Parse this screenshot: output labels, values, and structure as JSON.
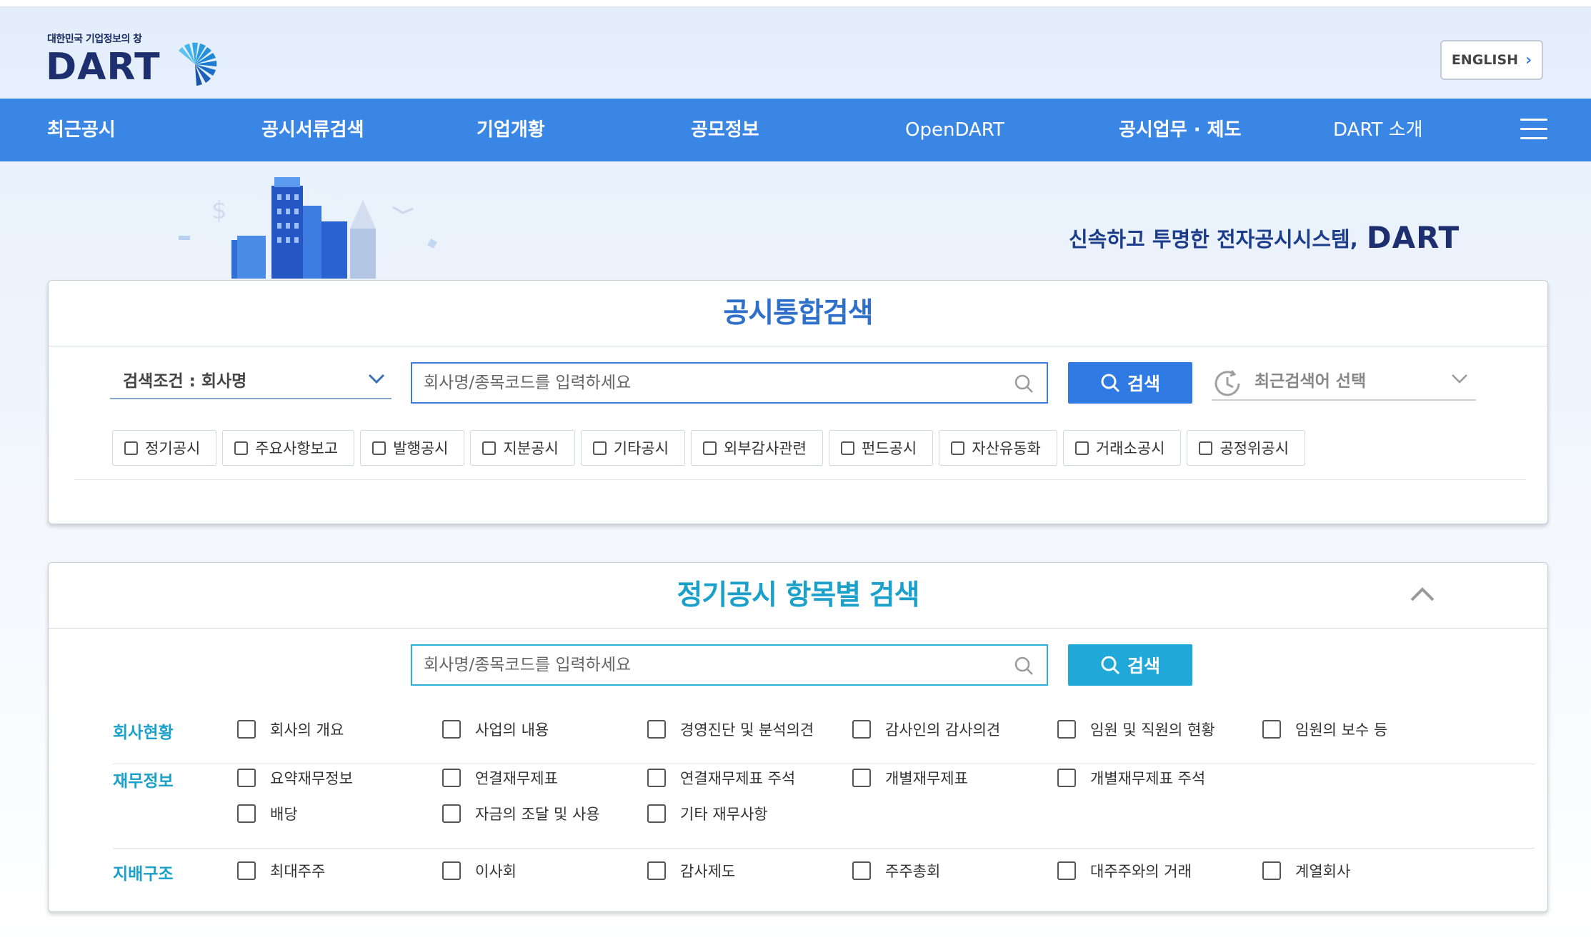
{
  "header": {
    "logo_tagline": "대한민국 기업정보의 창",
    "logo_word": "DART",
    "english_label": "ENGLISH"
  },
  "nav": {
    "items": [
      "최근공시",
      "공시서류검색",
      "기업개황",
      "공모정보",
      "OpenDART",
      "공시업무 · 제도",
      "DART 소개"
    ]
  },
  "hero": {
    "slogan": "신속하고 투명한 전자공시시스템,",
    "slogan_brand": "DART"
  },
  "integrated_search": {
    "title": "공시통합검색",
    "condition_label": "검색조건 : 회사명",
    "input_placeholder": "회사명/종목코드를 입력하세요",
    "search_button": "검색",
    "recent_placeholder": "최근검색어 선택",
    "checkboxes": [
      "정기공시",
      "주요사항보고",
      "발행공시",
      "지분공시",
      "기타공시",
      "외부감사관련",
      "펀드공시",
      "자산유동화",
      "거래소공시",
      "공정위공시"
    ]
  },
  "periodic_search": {
    "title": "정기공시 항목별 검색",
    "input_placeholder": "회사명/종목코드를 입력하세요",
    "search_button": "검색",
    "groups": [
      {
        "label": "회사현황",
        "items": [
          "회사의 개요",
          "사업의 내용",
          "경영진단 및 분석의견",
          "감사인의 감사의견",
          "임원 및 직원의 현황",
          "임원의 보수 등"
        ]
      },
      {
        "label": "재무정보",
        "items": [
          "요약재무정보",
          "연결재무제표",
          "연결재무제표 주석",
          "개별재무제표",
          "개별재무제표 주석",
          "배당",
          "자금의 조달 및 사용",
          "기타 재무사항"
        ]
      },
      {
        "label": "지배구조",
        "items": [
          "최대주주",
          "이사회",
          "감사제도",
          "주주총회",
          "대주주와의 거래",
          "계열회사"
        ]
      }
    ]
  },
  "colors": {
    "nav_bg": "#3a86e4",
    "primary_button": "#2f7be3",
    "secondary_button": "#1fa8d8",
    "brand_navy": "#1d2f6e"
  }
}
